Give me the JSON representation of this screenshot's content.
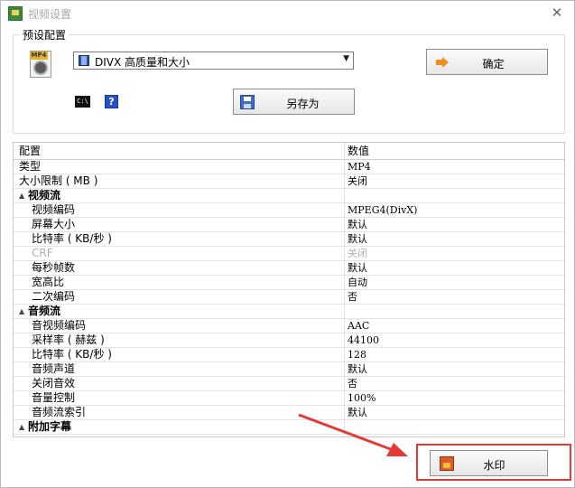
{
  "window": {
    "title": "视频设置",
    "close_glyph": "✕"
  },
  "preset": {
    "group_label": "预设配置",
    "file_icon_tag": "MP4",
    "profile_value": "DIVX 高质量和大小",
    "cmd_icon_text": "C:\\",
    "help_icon_text": "?",
    "ok_label": "确定",
    "save_as_label": "另存为"
  },
  "grid": {
    "headers": {
      "name": "配置",
      "value": "数值"
    },
    "rows": [
      {
        "type": "item",
        "name": "类型",
        "value": "MP4"
      },
      {
        "type": "item",
        "name": "大小限制 ( MB )",
        "value": "关闭"
      },
      {
        "type": "category",
        "name": "视频流",
        "value": ""
      },
      {
        "type": "sub",
        "name": "视频编码",
        "value": "MPEG4(DivX)"
      },
      {
        "type": "sub",
        "name": "屏幕大小",
        "value": "默认"
      },
      {
        "type": "sub",
        "name": "比特率 ( KB/秒 )",
        "value": "默认"
      },
      {
        "type": "sub-dim",
        "name": "CRF",
        "value": "关闭"
      },
      {
        "type": "sub",
        "name": "每秒帧数",
        "value": "默认"
      },
      {
        "type": "sub",
        "name": "宽高比",
        "value": "自动"
      },
      {
        "type": "sub",
        "name": "二次编码",
        "value": "否"
      },
      {
        "type": "category",
        "name": "音频流",
        "value": ""
      },
      {
        "type": "sub",
        "name": "音视频编码",
        "value": "AAC"
      },
      {
        "type": "sub",
        "name": "采样率 ( 赫兹 )",
        "value": "44100"
      },
      {
        "type": "sub",
        "name": "比特率 ( KB/秒 )",
        "value": "128"
      },
      {
        "type": "sub",
        "name": "音频声道",
        "value": "默认"
      },
      {
        "type": "sub",
        "name": "关闭音效",
        "value": "否"
      },
      {
        "type": "sub",
        "name": "音量控制",
        "value": "100%"
      },
      {
        "type": "sub",
        "name": "音频流索引",
        "value": "默认"
      },
      {
        "type": "category",
        "name": "附加字幕",
        "value": ""
      }
    ]
  },
  "footer": {
    "watermark_label": "水印"
  },
  "colors": {
    "highlight": "#e53935",
    "accent_orange": "#ef8e1a"
  },
  "icons": [
    "app-icon",
    "mp4-file-icon",
    "film-icon",
    "command-icon",
    "help-icon",
    "confirm-arrow-icon",
    "save-icon",
    "watermark-icon"
  ]
}
